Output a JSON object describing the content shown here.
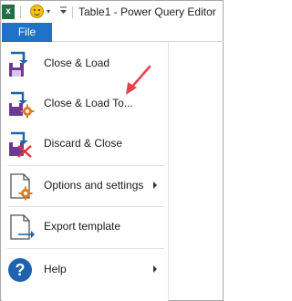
{
  "window": {
    "title": "Table1 - Power Query Editor",
    "app_icon": "excel-icon",
    "app_icon_letter": "x"
  },
  "quick_access": {
    "feedback_icon": "smiley-icon",
    "dropdown_glyph": "▾",
    "customize_glyph": "▾"
  },
  "ribbon": {
    "file_tab_label": "File"
  },
  "menu": {
    "items": [
      {
        "label": "Close & Load",
        "icon": "save-load-icon",
        "has_submenu": false
      },
      {
        "label": "Close & Load To...",
        "icon": "save-load-settings-icon",
        "has_submenu": false
      },
      {
        "label": "Discard & Close",
        "icon": "discard-close-icon",
        "has_submenu": false
      },
      {
        "label": "Options and settings",
        "icon": "options-document-icon",
        "has_submenu": true
      },
      {
        "label": "Export template",
        "icon": "export-template-icon",
        "has_submenu": false
      },
      {
        "label": "Help",
        "icon": "help-icon",
        "has_submenu": true
      }
    ]
  },
  "colors": {
    "file_tab": "#1f73c6",
    "annotation_arrow": "#e8434b",
    "excel_green": "#1e7145",
    "save_purple": "#6c3a93",
    "gear_orange": "#e07b24",
    "help_blue": "#1f63b0"
  },
  "annotation": {
    "arrow_target": "Close & Load To..."
  }
}
